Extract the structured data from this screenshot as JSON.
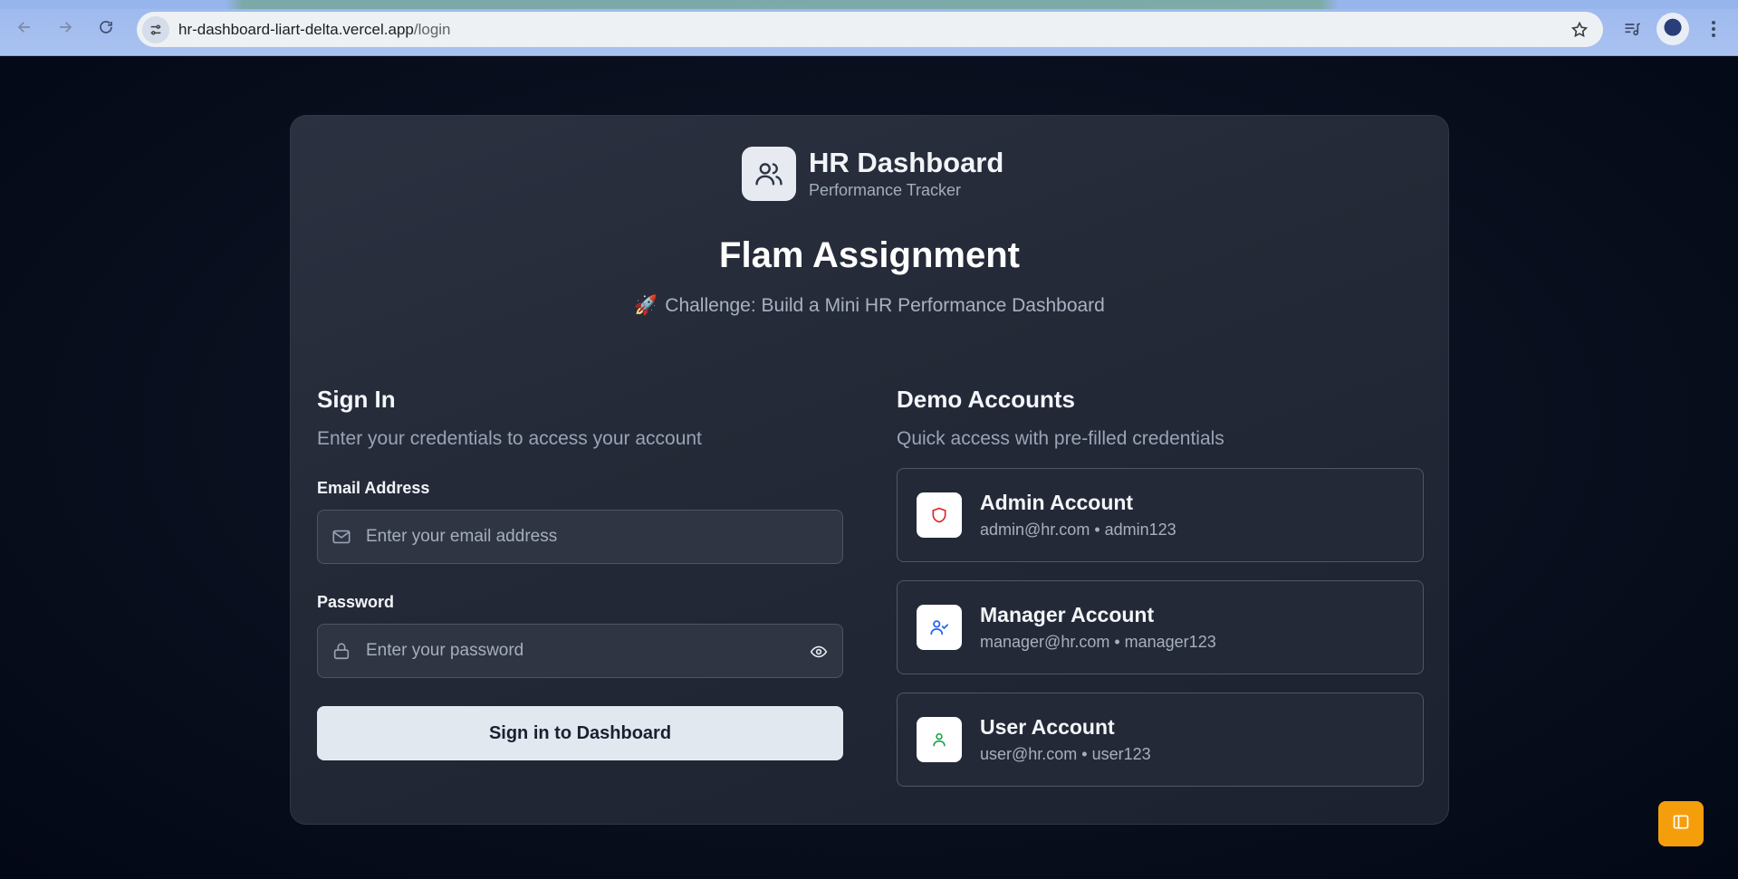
{
  "browser": {
    "url_host": "hr-dashboard-liart-delta.vercel.app",
    "url_path": "/login"
  },
  "brand": {
    "title": "HR Dashboard",
    "subtitle": "Performance Tracker"
  },
  "page": {
    "title": "Flam Assignment",
    "challenge_emoji": "🚀",
    "challenge_text": "Challenge: Build a Mini HR Performance Dashboard"
  },
  "signin": {
    "title": "Sign In",
    "description": "Enter your credentials to access your account",
    "email_label": "Email Address",
    "email_placeholder": "Enter your email address",
    "password_label": "Password",
    "password_placeholder": "Enter your password",
    "submit_label": "Sign in to Dashboard"
  },
  "demo": {
    "title": "Demo Accounts",
    "description": "Quick access with pre-filled credentials",
    "accounts": [
      {
        "name": "Admin Account",
        "credentials": "admin@hr.com • admin123",
        "icon": "shield-icon",
        "color": "#dc2626"
      },
      {
        "name": "Manager Account",
        "credentials": "manager@hr.com • manager123",
        "icon": "user-check-icon",
        "color": "#2563eb"
      },
      {
        "name": "User Account",
        "credentials": "user@hr.com • user123",
        "icon": "user-icon",
        "color": "#16a34a"
      }
    ]
  },
  "colors": {
    "accent_fab": "#f59e0b",
    "card_bg": "#232936",
    "page_bg": "#030816"
  }
}
